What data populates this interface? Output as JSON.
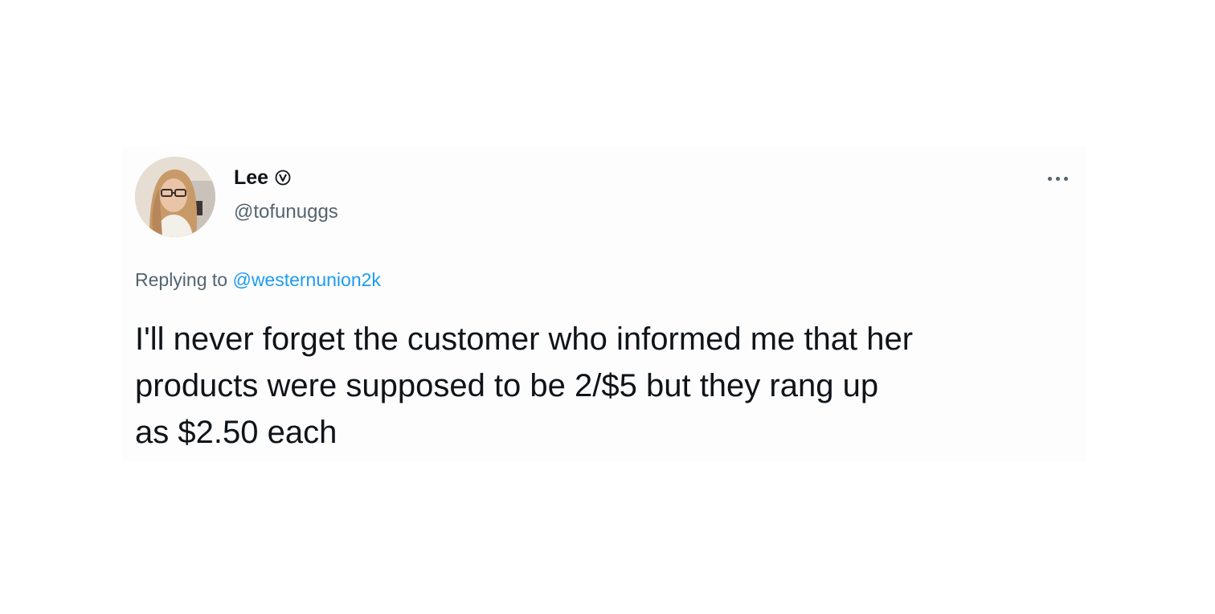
{
  "tweet": {
    "author": {
      "display_name": "Lee",
      "handle": "@tofunuggs",
      "avatar_icon": "profile-photo-avatar",
      "badge_icon": "verified-v-badge-icon"
    },
    "more_icon": "ellipsis-horizontal-icon",
    "reply": {
      "prefix": "Replying to ",
      "mention": "@westernunion2k"
    },
    "lines": [
      "I'll never forget the customer who informed me that her",
      "products were supposed to be 2/$5 but they rang up",
      "as $2.50 each"
    ]
  },
  "colors": {
    "text": "#0f1419",
    "secondary": "#536471",
    "link": "#1d9bf0",
    "card_background": "#fdfdfd"
  }
}
